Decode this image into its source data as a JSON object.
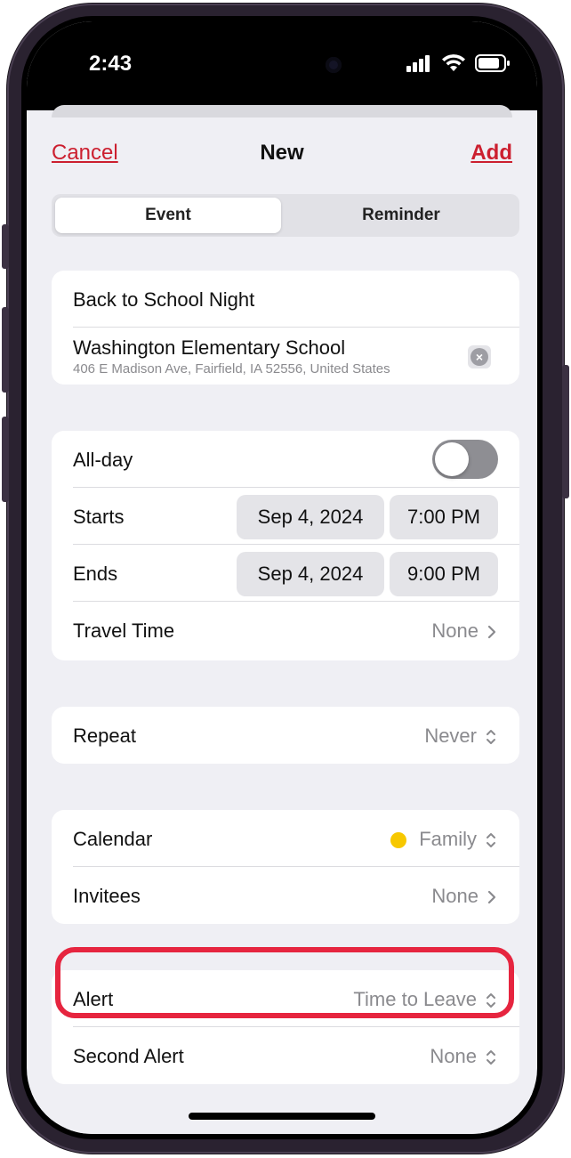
{
  "status": {
    "time": "2:43",
    "icons": [
      "cellular-signal-icon",
      "wifi-icon",
      "battery-icon"
    ]
  },
  "nav": {
    "cancel": "Cancel",
    "title": "New",
    "add": "Add"
  },
  "tabs": [
    {
      "label": "Event",
      "selected": true
    },
    {
      "label": "Reminder",
      "selected": false
    }
  ],
  "event": {
    "title": "Back to School Night",
    "location_name": "Washington Elementary School",
    "location_address": "406 E Madison Ave, Fairfield, IA  52556, United States"
  },
  "timing": {
    "allday_label": "All-day",
    "allday_on": false,
    "starts_label": "Starts",
    "starts_date": "Sep 4, 2024",
    "starts_time": "7:00 PM",
    "ends_label": "Ends",
    "ends_date": "Sep 4, 2024",
    "ends_time": "9:00 PM",
    "travel_label": "Travel Time",
    "travel_value": "None"
  },
  "repeat": {
    "label": "Repeat",
    "value": "Never"
  },
  "calendar": {
    "label": "Calendar",
    "value": "Family",
    "color": "#f7c800",
    "invitees_label": "Invitees",
    "invitees_value": "None"
  },
  "alerts": {
    "alert_label": "Alert",
    "alert_value": "Time to Leave",
    "second_label": "Second Alert",
    "second_value": "None"
  },
  "colors": {
    "accent": "#cc1f2f",
    "highlight": "#e6253f"
  }
}
